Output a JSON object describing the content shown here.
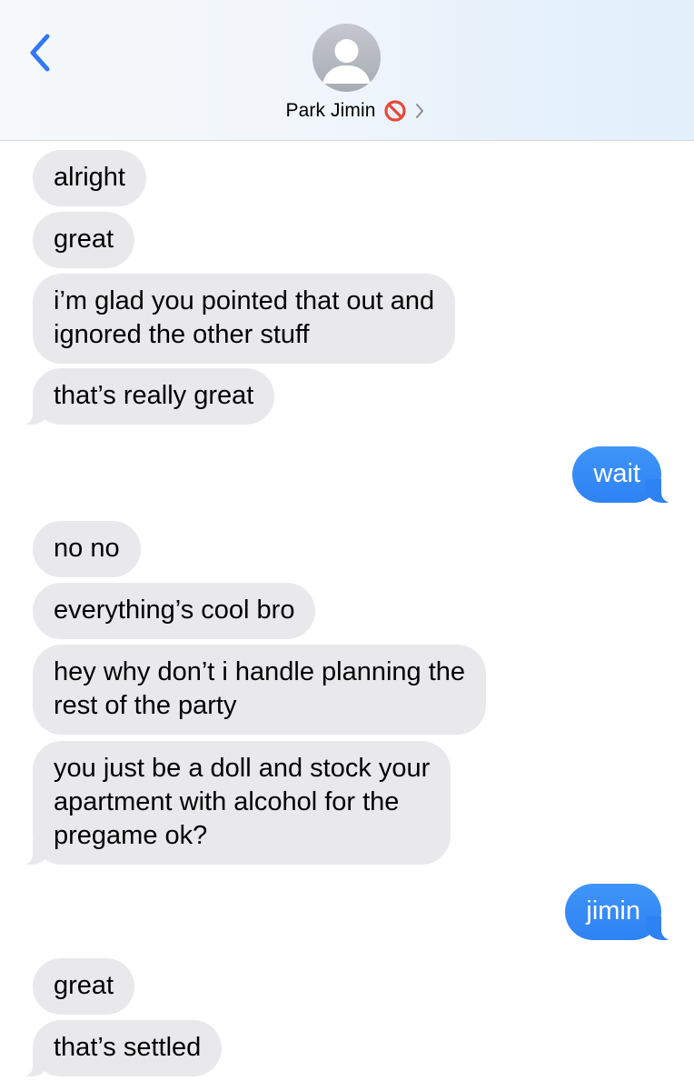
{
  "header": {
    "contact_name": "Park Jimin",
    "back_icon": "chevron-left-icon",
    "status_icon": "prohibited-emoji-icon",
    "disclosure_icon": "chevron-right-icon",
    "accent_color": "#3478f6"
  },
  "messages": [
    {
      "direction": "incoming",
      "text": "alright"
    },
    {
      "direction": "incoming",
      "text": "great"
    },
    {
      "direction": "incoming",
      "lines": [
        "i’m glad you pointed that out and",
        "ignored the other stuff"
      ]
    },
    {
      "direction": "incoming",
      "text": "that’s really great"
    },
    {
      "direction": "outgoing",
      "text": "wait"
    },
    {
      "direction": "incoming",
      "text": "no no"
    },
    {
      "direction": "incoming",
      "text": "everything’s cool bro"
    },
    {
      "direction": "incoming",
      "lines": [
        "hey why don’t i handle planning the",
        "rest of the party"
      ]
    },
    {
      "direction": "incoming",
      "lines": [
        "you just be a doll and stock your",
        "apartment with alcohol for the",
        "pregame ok?"
      ]
    },
    {
      "direction": "outgoing",
      "text": "jimin"
    },
    {
      "direction": "incoming",
      "text": "great"
    },
    {
      "direction": "incoming",
      "text": "that’s settled"
    }
  ],
  "colors": {
    "incoming_bubble": "#e9e9eb",
    "outgoing_bubble": "#3e8ff6"
  }
}
